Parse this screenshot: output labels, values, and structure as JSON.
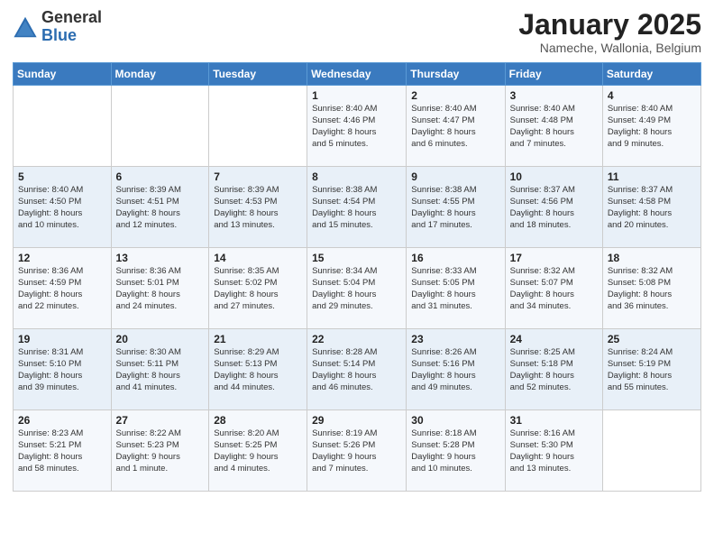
{
  "logo": {
    "general": "General",
    "blue": "Blue"
  },
  "title": "January 2025",
  "subtitle": "Nameche, Wallonia, Belgium",
  "days_of_week": [
    "Sunday",
    "Monday",
    "Tuesday",
    "Wednesday",
    "Thursday",
    "Friday",
    "Saturday"
  ],
  "weeks": [
    [
      {
        "day": "",
        "info": ""
      },
      {
        "day": "",
        "info": ""
      },
      {
        "day": "",
        "info": ""
      },
      {
        "day": "1",
        "info": "Sunrise: 8:40 AM\nSunset: 4:46 PM\nDaylight: 8 hours\nand 5 minutes."
      },
      {
        "day": "2",
        "info": "Sunrise: 8:40 AM\nSunset: 4:47 PM\nDaylight: 8 hours\nand 6 minutes."
      },
      {
        "day": "3",
        "info": "Sunrise: 8:40 AM\nSunset: 4:48 PM\nDaylight: 8 hours\nand 7 minutes."
      },
      {
        "day": "4",
        "info": "Sunrise: 8:40 AM\nSunset: 4:49 PM\nDaylight: 8 hours\nand 9 minutes."
      }
    ],
    [
      {
        "day": "5",
        "info": "Sunrise: 8:40 AM\nSunset: 4:50 PM\nDaylight: 8 hours\nand 10 minutes."
      },
      {
        "day": "6",
        "info": "Sunrise: 8:39 AM\nSunset: 4:51 PM\nDaylight: 8 hours\nand 12 minutes."
      },
      {
        "day": "7",
        "info": "Sunrise: 8:39 AM\nSunset: 4:53 PM\nDaylight: 8 hours\nand 13 minutes."
      },
      {
        "day": "8",
        "info": "Sunrise: 8:38 AM\nSunset: 4:54 PM\nDaylight: 8 hours\nand 15 minutes."
      },
      {
        "day": "9",
        "info": "Sunrise: 8:38 AM\nSunset: 4:55 PM\nDaylight: 8 hours\nand 17 minutes."
      },
      {
        "day": "10",
        "info": "Sunrise: 8:37 AM\nSunset: 4:56 PM\nDaylight: 8 hours\nand 18 minutes."
      },
      {
        "day": "11",
        "info": "Sunrise: 8:37 AM\nSunset: 4:58 PM\nDaylight: 8 hours\nand 20 minutes."
      }
    ],
    [
      {
        "day": "12",
        "info": "Sunrise: 8:36 AM\nSunset: 4:59 PM\nDaylight: 8 hours\nand 22 minutes."
      },
      {
        "day": "13",
        "info": "Sunrise: 8:36 AM\nSunset: 5:01 PM\nDaylight: 8 hours\nand 24 minutes."
      },
      {
        "day": "14",
        "info": "Sunrise: 8:35 AM\nSunset: 5:02 PM\nDaylight: 8 hours\nand 27 minutes."
      },
      {
        "day": "15",
        "info": "Sunrise: 8:34 AM\nSunset: 5:04 PM\nDaylight: 8 hours\nand 29 minutes."
      },
      {
        "day": "16",
        "info": "Sunrise: 8:33 AM\nSunset: 5:05 PM\nDaylight: 8 hours\nand 31 minutes."
      },
      {
        "day": "17",
        "info": "Sunrise: 8:32 AM\nSunset: 5:07 PM\nDaylight: 8 hours\nand 34 minutes."
      },
      {
        "day": "18",
        "info": "Sunrise: 8:32 AM\nSunset: 5:08 PM\nDaylight: 8 hours\nand 36 minutes."
      }
    ],
    [
      {
        "day": "19",
        "info": "Sunrise: 8:31 AM\nSunset: 5:10 PM\nDaylight: 8 hours\nand 39 minutes."
      },
      {
        "day": "20",
        "info": "Sunrise: 8:30 AM\nSunset: 5:11 PM\nDaylight: 8 hours\nand 41 minutes."
      },
      {
        "day": "21",
        "info": "Sunrise: 8:29 AM\nSunset: 5:13 PM\nDaylight: 8 hours\nand 44 minutes."
      },
      {
        "day": "22",
        "info": "Sunrise: 8:28 AM\nSunset: 5:14 PM\nDaylight: 8 hours\nand 46 minutes."
      },
      {
        "day": "23",
        "info": "Sunrise: 8:26 AM\nSunset: 5:16 PM\nDaylight: 8 hours\nand 49 minutes."
      },
      {
        "day": "24",
        "info": "Sunrise: 8:25 AM\nSunset: 5:18 PM\nDaylight: 8 hours\nand 52 minutes."
      },
      {
        "day": "25",
        "info": "Sunrise: 8:24 AM\nSunset: 5:19 PM\nDaylight: 8 hours\nand 55 minutes."
      }
    ],
    [
      {
        "day": "26",
        "info": "Sunrise: 8:23 AM\nSunset: 5:21 PM\nDaylight: 8 hours\nand 58 minutes."
      },
      {
        "day": "27",
        "info": "Sunrise: 8:22 AM\nSunset: 5:23 PM\nDaylight: 9 hours\nand 1 minute."
      },
      {
        "day": "28",
        "info": "Sunrise: 8:20 AM\nSunset: 5:25 PM\nDaylight: 9 hours\nand 4 minutes."
      },
      {
        "day": "29",
        "info": "Sunrise: 8:19 AM\nSunset: 5:26 PM\nDaylight: 9 hours\nand 7 minutes."
      },
      {
        "day": "30",
        "info": "Sunrise: 8:18 AM\nSunset: 5:28 PM\nDaylight: 9 hours\nand 10 minutes."
      },
      {
        "day": "31",
        "info": "Sunrise: 8:16 AM\nSunset: 5:30 PM\nDaylight: 9 hours\nand 13 minutes."
      },
      {
        "day": "",
        "info": ""
      }
    ]
  ]
}
